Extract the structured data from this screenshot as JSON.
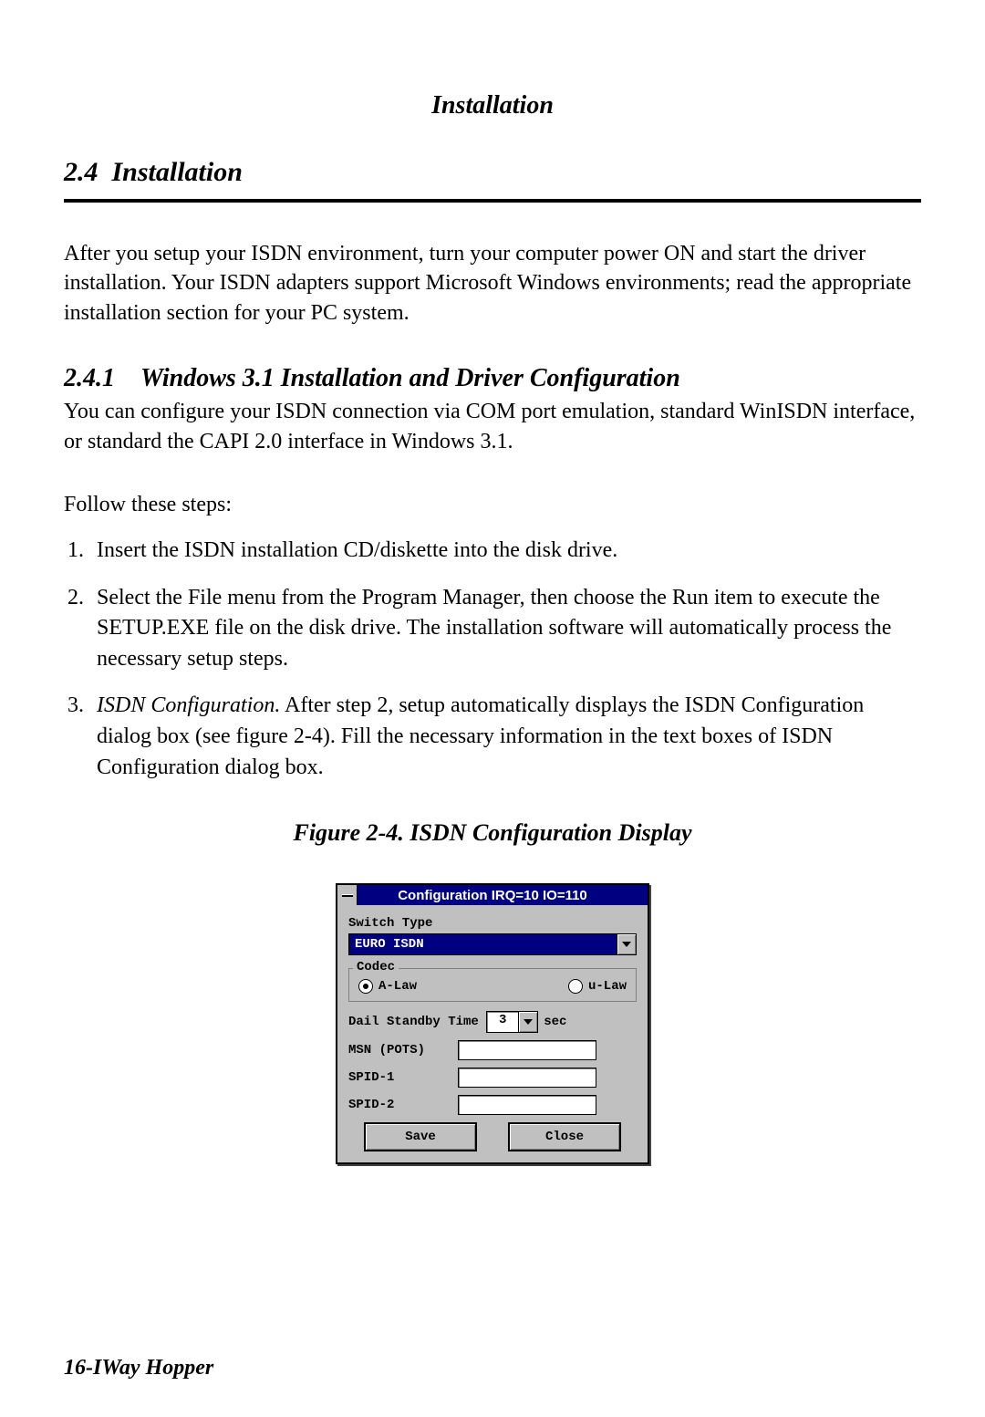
{
  "chapter_header": "Installation",
  "section": {
    "number": "2.4",
    "title": "Installation"
  },
  "intro_paragraph": "After you setup your ISDN environment, turn your computer power ON and start the driver installation.  Your ISDN adapters support Microsoft Windows environments; read the appropriate installation section for your PC system.",
  "subsection": {
    "number": "2.4.1",
    "title": "Windows 3.1 Installation and Driver Configuration",
    "intro": "You can configure your ISDN connection via COM port emulation, standard WinISDN interface, or standard the CAPI 2.0 interface in Windows 3.1.",
    "follow_label": "Follow these steps:",
    "steps": [
      {
        "text": "Insert the ISDN installation CD/diskette into the disk drive."
      },
      {
        "text": "Select the File menu from the Program Manager, then choose the Run item to execute the SETUP.EXE file on the disk drive.  The installation software will automatically process the necessary setup steps."
      },
      {
        "lead_italic": "ISDN Configuration.",
        "rest": "  After step 2, setup automatically displays the ISDN Configuration dialog box (see figure 2-4).  Fill the necessary information in the text boxes of ISDN Configuration dialog box."
      }
    ]
  },
  "figure_caption": "Figure 2-4. ISDN Configuration Display",
  "dialog": {
    "title": "Configuration IRQ=10 IO=110",
    "switch_type_label": "Switch Type",
    "switch_type_value": "EURO ISDN",
    "codec_label": "Codec",
    "codec_options": {
      "a_law": "A-Law",
      "u_law": "u-Law"
    },
    "codec_selected": "a_law",
    "standby_label": "Dail Standby Time",
    "standby_value": "3",
    "standby_unit": "sec",
    "fields": {
      "msn_label": "MSN (POTS)",
      "spid1_label": "SPID-1",
      "spid2_label": "SPID-2",
      "msn_value": "",
      "spid1_value": "",
      "spid2_value": ""
    },
    "buttons": {
      "save": "Save",
      "close": "Close"
    }
  },
  "footer": "16-IWay Hopper"
}
